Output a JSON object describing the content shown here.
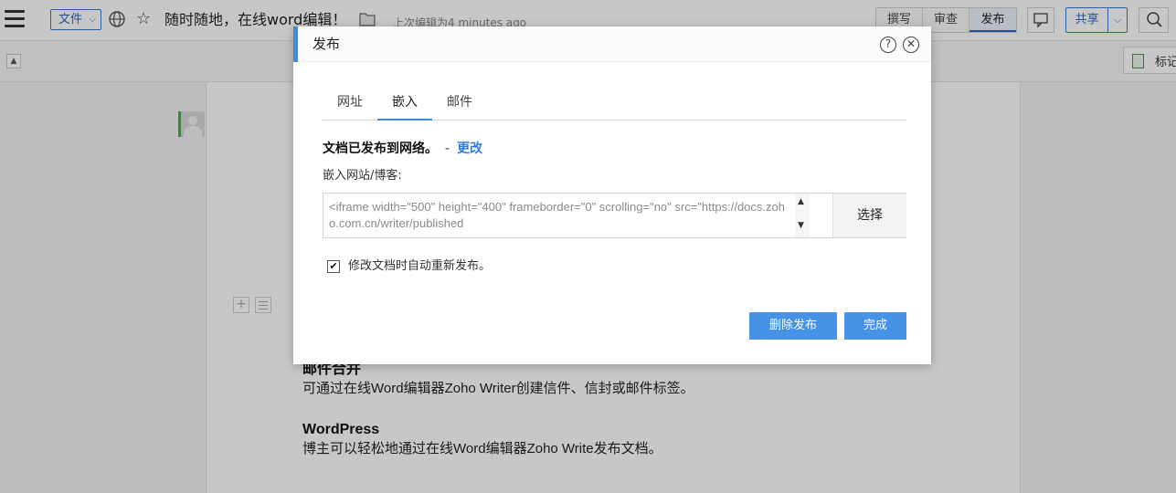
{
  "topbar": {
    "file_menu": "文件",
    "doc_title": "随时随地，在线word编辑！",
    "last_edited": "上次编辑为4 minutes ago",
    "mode_tabs": [
      "撰写",
      "审查",
      "发布"
    ],
    "share": "共享"
  },
  "subbar": {
    "markup_label": "标记"
  },
  "document": {
    "sections": [
      {
        "heading": "邮件合并",
        "body": "可通过在线Word编辑器Zoho Writer创建信件、信封或邮件标签。"
      },
      {
        "heading": "WordPress",
        "body": "博主可以轻松地通过在线Word编辑器Zoho Write发布文档。"
      }
    ]
  },
  "dialog": {
    "title": "发布",
    "tabs": [
      "网址",
      "嵌入",
      "邮件"
    ],
    "active_tab": "嵌入",
    "status_text": "文档已发布到网络。",
    "status_dash": "-",
    "change_link": "更改",
    "embed_label": "嵌入网站/博客:",
    "embed_code": "<iframe width=\"500\" height=\"400\" frameborder=\"0\" scrolling=\"no\" src=\"https://docs.zoho.com.cn/writer/published",
    "select_button": "选择",
    "auto_republish_checked": true,
    "auto_republish_label": "修改文档时自动重新发布。",
    "unpublish_button": "删除发布",
    "done_button": "完成"
  },
  "colors": {
    "accent": "#3b8de0",
    "link": "#2d7fd9",
    "primary_button": "#4592e6"
  }
}
